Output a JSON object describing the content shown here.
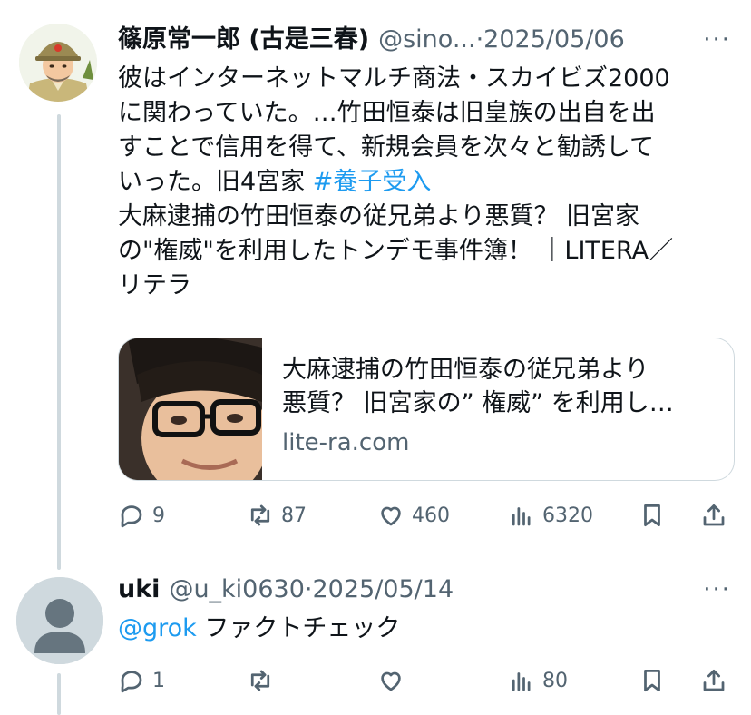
{
  "tweets": [
    {
      "name": "篠原常一郎 (古是三春)",
      "handle": "@sino...",
      "sep": "·",
      "date": "2025/05/06",
      "more": "···",
      "lines": [
        "彼はインターネットマルチ商法・スカイビズ2000",
        "に関わっていた。…竹田恒泰は旧皇族の出自を出",
        "すことで信用を得て、新規会員を次々と勧誘して",
        "いった。旧4宮家 ",
        "大麻逮捕の竹田恒泰の従兄弟より悪質？ 旧宮家",
        "の\"権威\"を利用したトンデモ事件簿！ ｜LITERA／",
        "リテラ"
      ],
      "hashtag": "#養子受入",
      "card": {
        "title_line1": "大麻逮捕の竹田恒泰の従兄弟より",
        "title_line2": "悪質？ 旧宮家の” 権威” を利用し…",
        "domain": "lite-ra.com"
      },
      "actions": {
        "replies": "9",
        "retweets": "87",
        "likes": "460",
        "views": "6320"
      }
    },
    {
      "name": "uki",
      "handle": "@u_ki0630",
      "sep": "·",
      "date": "2025/05/14",
      "more": "···",
      "mention": "@grok",
      "text": " ファクトチェック",
      "actions": {
        "replies": "1",
        "retweets": "",
        "likes": "",
        "views": "80"
      }
    }
  ],
  "colors": {
    "accent": "#1d9bf0",
    "secondary_text": "#536471",
    "primary_text": "#0f1419",
    "divider": "#cfd9de"
  },
  "icons": [
    "reply-icon",
    "retweet-icon",
    "like-icon",
    "views-icon",
    "bookmark-icon",
    "share-icon",
    "more-icon"
  ]
}
